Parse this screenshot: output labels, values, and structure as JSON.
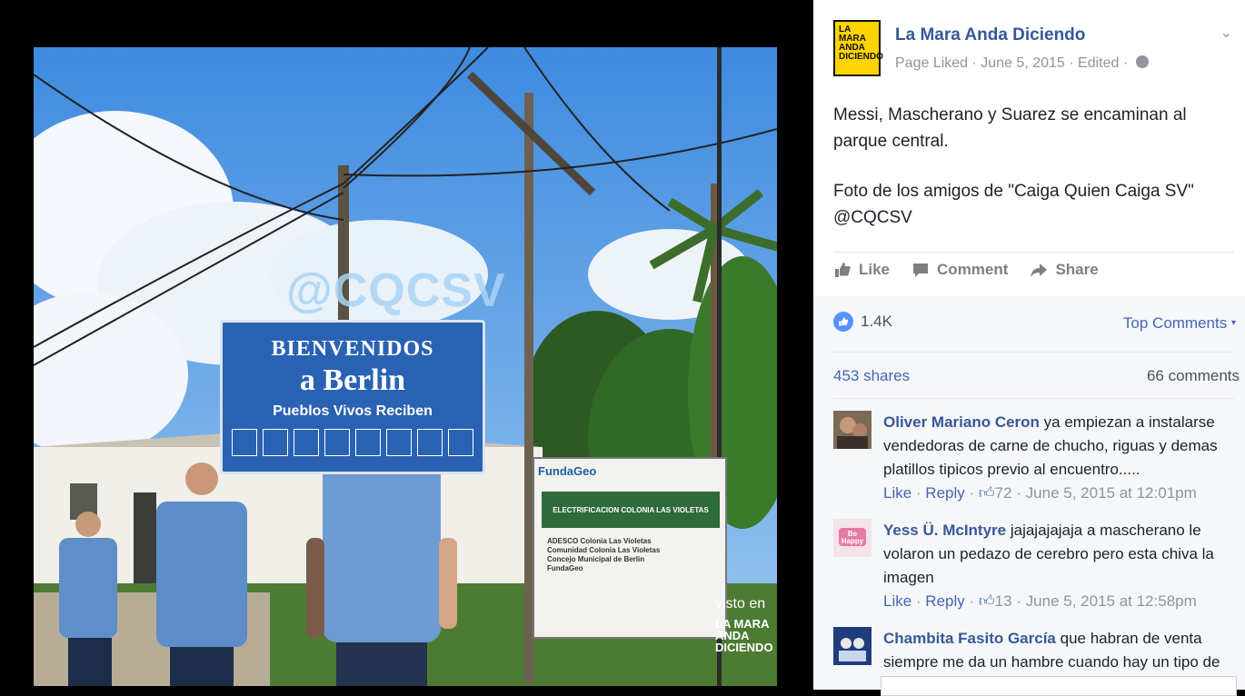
{
  "photo": {
    "watermark": "@CQCSV",
    "sign_main": {
      "line1": "BIENVENIDOS",
      "line2": "a Berlin",
      "line3": "Pueblos Vivos Reciben"
    },
    "sign_right": {
      "brand": "FundaGeo",
      "banner": "ELECTRIFICACION COLONIA LAS VIOLETAS",
      "items": [
        "ADESCO Colonia Las Violetas",
        "Comunidad Colonia Las Violetas",
        "Concejo Municipal de Berlin",
        "FundaGeo"
      ]
    },
    "seen_in": "visto en",
    "logo_text": "LA MARA ANDA DICIENDO"
  },
  "post": {
    "page_name": "La Mara Anda Diciendo",
    "avatar_text": "LA MARA ANDA DICIENDO",
    "meta": "Page Liked · June 5, 2015 · Edited ·",
    "text_p1": "Messi, Mascherano y Suarez se encaminan al parque central.",
    "text_p2": "Foto de los amigos de \"Caiga Quien Caiga SV\" @CQCSV",
    "actions": {
      "like": "Like",
      "comment": "Comment",
      "share": "Share"
    },
    "reaction_count": "1.4K",
    "top_comments": "Top Comments",
    "shares": "453 shares",
    "comments_count": "66 comments"
  },
  "comments": [
    {
      "author": "Oliver Mariano Ceron",
      "text": " ya empiezan a instalarse vendedoras de carne de chucho, riguas y demas platillos tipicos previo al encuentro.....",
      "like": "Like",
      "reply": "Reply",
      "likes": "72",
      "time": "June 5, 2015 at 12:01pm",
      "avatar_color": "#6b4f3a"
    },
    {
      "author": "Yess Ü. McIntyre",
      "text": " jajajajajaja a mascherano le volaron un pedazo de cerebro pero esta chiva la imagen",
      "like": "Like",
      "reply": "Reply",
      "likes": "13",
      "time": "June 5, 2015 at 12:58pm",
      "avatar_text": "Be Happy",
      "avatar_color": "#f7d3e0"
    },
    {
      "author": "Chambita Fasito García",
      "text": " que habran de venta siempre me da un hambre cuando hay un tipo de",
      "avatar_color": "#1f3d7a"
    }
  ]
}
